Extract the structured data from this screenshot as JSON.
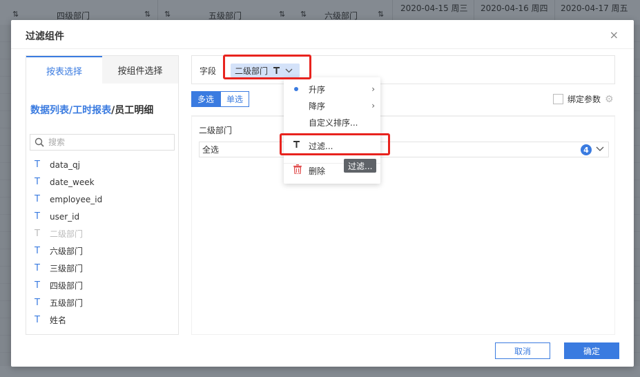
{
  "background": {
    "columns": [
      {
        "label": "四级部门"
      },
      {
        "label": "五级部门"
      },
      {
        "label": "六级部门"
      }
    ],
    "dates": [
      "2020-04-15 周三",
      "2020-04-16 周四",
      "2020-04-17 周五"
    ]
  },
  "dialog": {
    "title": "过滤组件",
    "close_icon": "×",
    "left": {
      "tabs": [
        {
          "label": "按表选择",
          "active": true
        },
        {
          "label": "按组件选择",
          "active": false
        }
      ],
      "path_links": "数据列表/工时报表",
      "path_tail": "/员工明细",
      "search_placeholder": "搜索",
      "fields": [
        {
          "name": "data_qj",
          "type_icon": "T",
          "disabled": false
        },
        {
          "name": "date_week",
          "type_icon": "T",
          "disabled": false
        },
        {
          "name": "employee_id",
          "type_icon": "T",
          "disabled": false
        },
        {
          "name": "user_id",
          "type_icon": "T",
          "disabled": false
        },
        {
          "name": "二级部门",
          "type_icon": "T",
          "disabled": true
        },
        {
          "name": "六级部门",
          "type_icon": "T",
          "disabled": false
        },
        {
          "name": "三级部门",
          "type_icon": "T",
          "disabled": false
        },
        {
          "name": "四级部门",
          "type_icon": "T",
          "disabled": false
        },
        {
          "name": "五级部门",
          "type_icon": "T",
          "disabled": false
        },
        {
          "name": "姓名",
          "type_icon": "T",
          "disabled": false
        }
      ]
    },
    "right": {
      "field_label": "字段",
      "field_chip": "二级部门",
      "modes": [
        {
          "label": "多选",
          "active": true
        },
        {
          "label": "单选",
          "active": false
        }
      ],
      "bind_param": "绑定参数",
      "filter_title": "二级部门",
      "select_value": "全选",
      "selected_count": "4"
    },
    "menu": {
      "items": [
        {
          "label": "升序",
          "selected": true,
          "has_sub": true
        },
        {
          "label": "降序",
          "selected": false,
          "has_sub": true
        },
        {
          "label": "自定义排序...",
          "selected": false,
          "has_sub": false
        },
        {
          "label": "过滤...",
          "icon": "filter-icon"
        },
        {
          "label": "删除",
          "icon": "trash-icon"
        }
      ],
      "tooltip": "过滤..."
    },
    "buttons": {
      "cancel": "取消",
      "ok": "确定"
    }
  },
  "colors": {
    "accent": "#3a7be0",
    "highlight_box": "#e8231e",
    "overlay": "#7f858c"
  }
}
